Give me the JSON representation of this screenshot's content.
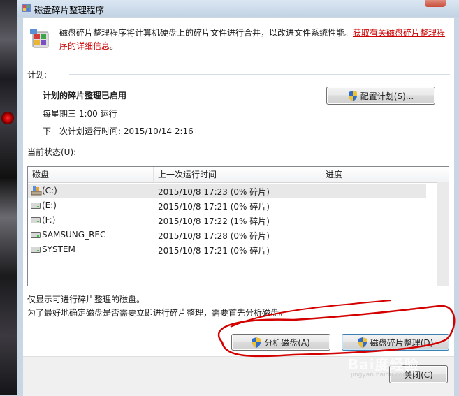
{
  "window": {
    "title": "磁盘碎片整理程序"
  },
  "header": {
    "description": "磁盘碎片整理程序将计算机硬盘上的碎片文件进行合并，以改进文件系统性能。",
    "link_text": "获取有关磁盘碎片整理程序的详细信息",
    "link_suffix": "。"
  },
  "schedule": {
    "section_label": "计划:",
    "status": "计划的碎片整理已启用",
    "frequency": "每星期三  1:00 运行",
    "next_run": "下一次计划运行时间: 2015/10/14 2:16",
    "configure_button": "配置计划(S)..."
  },
  "current_status": {
    "section_label": "当前状态(U):",
    "columns": [
      "磁盘",
      "上一次运行时间",
      "进度"
    ],
    "rows": [
      {
        "disk": "(C:)",
        "last_run": "2015/10/8 17:23 (0% 碎片)",
        "progress": "",
        "icon": "system-drive-icon"
      },
      {
        "disk": "(E:)",
        "last_run": "2015/10/8 17:21 (0% 碎片)",
        "progress": "",
        "icon": "drive-icon"
      },
      {
        "disk": "(F:)",
        "last_run": "2015/10/8 17:22 (1% 碎片)",
        "progress": "",
        "icon": "drive-icon"
      },
      {
        "disk": "SAMSUNG_REC",
        "last_run": "2015/10/8 17:28 (0% 碎片)",
        "progress": "",
        "icon": "drive-icon"
      },
      {
        "disk": "SYSTEM",
        "last_run": "2015/10/8 17:21 (0% 碎片)",
        "progress": "",
        "icon": "drive-icon"
      }
    ]
  },
  "notes": {
    "line1": "仅显示可进行碎片整理的磁盘。",
    "line2": "为了最好地确定磁盘是否需要立即进行碎片整理，需要首先分析磁盘。"
  },
  "actions": {
    "analyze_button": "分析磁盘(A)",
    "defrag_button": "磁盘碎片整理(D)",
    "close_button": "关闭(C)"
  },
  "watermark": {
    "text": "Bai度经验",
    "url": "jingyan.baidu.com"
  },
  "colors": {
    "link": "#cc0000",
    "annotation": "#d40000",
    "titlebar": "#c3d3e4"
  }
}
